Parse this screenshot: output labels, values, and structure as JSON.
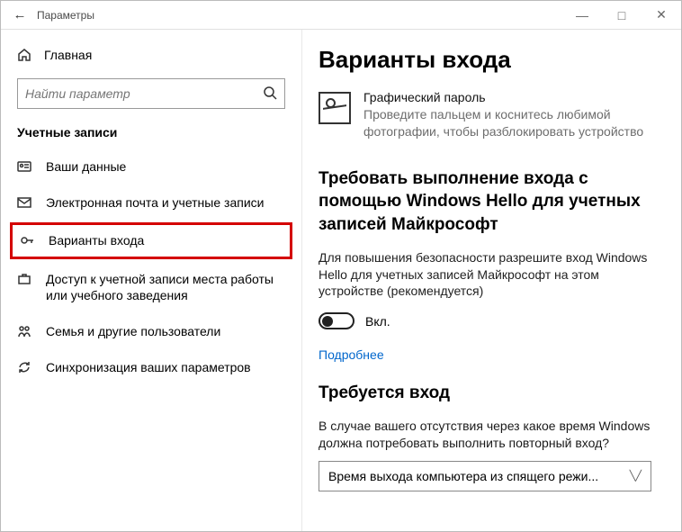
{
  "titlebar": {
    "title": "Параметры",
    "back_glyph": "←",
    "minimize_glyph": "—",
    "maximize_glyph": "□",
    "close_glyph": "✕"
  },
  "sidebar": {
    "home_label": "Главная",
    "search_placeholder": "Найти параметр",
    "section_title": "Учетные записи",
    "items": [
      {
        "label": "Ваши данные",
        "icon": "user"
      },
      {
        "label": "Электронная почта и учетные записи",
        "icon": "mail"
      },
      {
        "label": "Варианты входа",
        "icon": "key",
        "highlight": true
      },
      {
        "label": "Доступ к учетной записи места работы или учебного заведения",
        "icon": "briefcase"
      },
      {
        "label": "Семья и другие пользователи",
        "icon": "family"
      },
      {
        "label": "Синхронизация ваших параметров",
        "icon": "sync"
      }
    ]
  },
  "content": {
    "page_title": "Варианты входа",
    "picture_password": {
      "title": "Графический пароль",
      "subtitle": "Проведите пальцем и коснитесь любимой фотографии, чтобы разблокировать устройство"
    },
    "hello_section": {
      "heading": "Требовать выполнение входа с помощью Windows Hello для учетных записей Майкрософт",
      "description": "Для повышения безопасности разрешите вход Windows Hello для учетных записей Майкрософт на этом устройстве (рекомендуется)",
      "toggle_state": "on",
      "toggle_label": "Вкл.",
      "learn_more": "Подробнее"
    },
    "require_section": {
      "heading": "Требуется вход",
      "question": "В случае вашего отсутствия через какое время Windows должна потребовать выполнить повторный вход?",
      "dropdown_value": "Время выхода компьютера из спящего режи..."
    }
  },
  "annotation": {
    "arrow_color": "#d40000"
  }
}
